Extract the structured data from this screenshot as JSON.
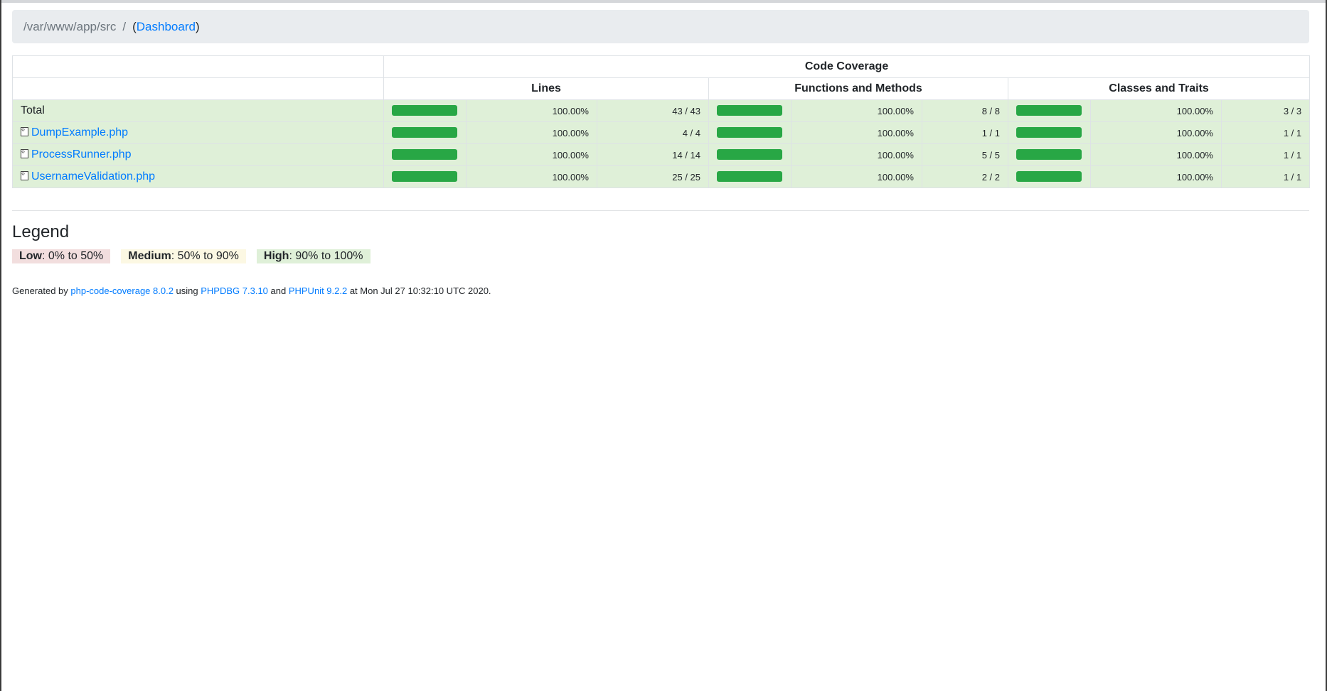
{
  "breadcrumb": {
    "path": "/var/www/app/src",
    "separator": "/",
    "paren_open": "(",
    "dashboard_link": "Dashboard",
    "paren_close": ")"
  },
  "table": {
    "header": "Code Coverage",
    "groups": [
      "Lines",
      "Functions and Methods",
      "Classes and Traits"
    ],
    "rows": [
      {
        "name": "Total",
        "is_file": false,
        "lines": {
          "pct": "100.00%",
          "count": "43 / 43",
          "fill": 100
        },
        "functions": {
          "pct": "100.00%",
          "count": "8 / 8",
          "fill": 100
        },
        "classes": {
          "pct": "100.00%",
          "count": "3 / 3",
          "fill": 100
        }
      },
      {
        "name": "DumpExample.php",
        "is_file": true,
        "lines": {
          "pct": "100.00%",
          "count": "4 / 4",
          "fill": 100
        },
        "functions": {
          "pct": "100.00%",
          "count": "1 / 1",
          "fill": 100
        },
        "classes": {
          "pct": "100.00%",
          "count": "1 / 1",
          "fill": 100
        }
      },
      {
        "name": "ProcessRunner.php",
        "is_file": true,
        "lines": {
          "pct": "100.00%",
          "count": "14 / 14",
          "fill": 100
        },
        "functions": {
          "pct": "100.00%",
          "count": "5 / 5",
          "fill": 100
        },
        "classes": {
          "pct": "100.00%",
          "count": "1 / 1",
          "fill": 100
        }
      },
      {
        "name": "UsernameValidation.php",
        "is_file": true,
        "lines": {
          "pct": "100.00%",
          "count": "25 / 25",
          "fill": 100
        },
        "functions": {
          "pct": "100.00%",
          "count": "2 / 2",
          "fill": 100
        },
        "classes": {
          "pct": "100.00%",
          "count": "1 / 1",
          "fill": 100
        }
      }
    ]
  },
  "legend": {
    "title": "Legend",
    "low": {
      "label": "Low",
      "range": ": 0% to 50%"
    },
    "medium": {
      "label": "Medium",
      "range": ": 50% to 90%"
    },
    "high": {
      "label": "High",
      "range": ": 90% to 100%"
    }
  },
  "footer": {
    "prefix": "Generated by ",
    "tool_link": "php-code-coverage 8.0.2",
    "using": " using ",
    "runtime_link": "PHPDBG 7.3.10",
    "and": " and ",
    "phpunit_link": "PHPUnit 9.2.2",
    "suffix": " at Mon Jul 27 10:32:10 UTC 2020."
  },
  "colors": {
    "bar": "#28a745",
    "row_success": "#dff0d8",
    "link": "#007bff",
    "low": "#f2dede",
    "medium": "#fcf8e3"
  }
}
